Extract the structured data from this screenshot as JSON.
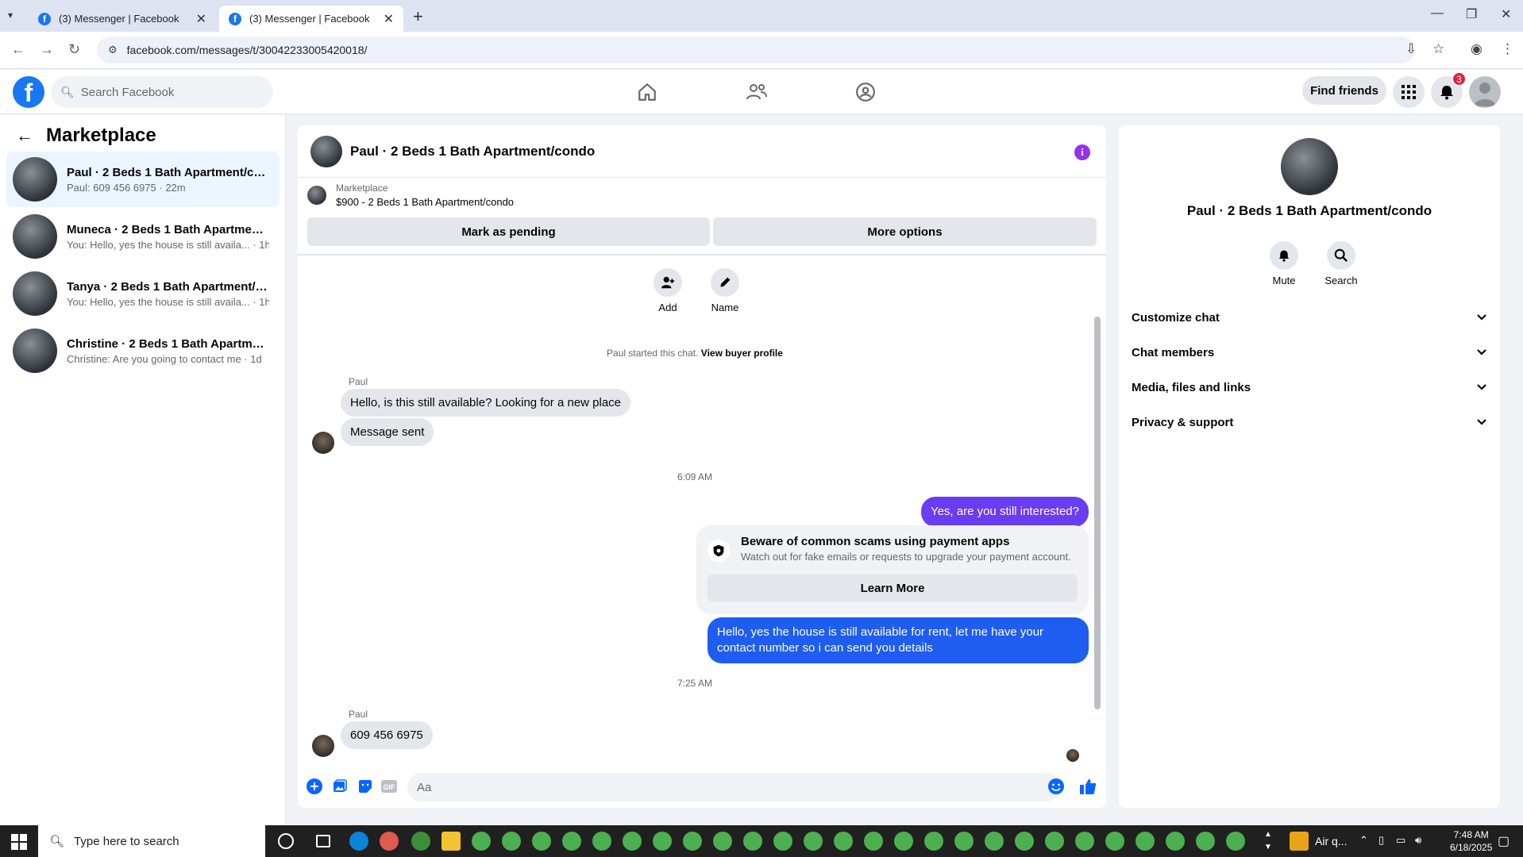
{
  "browser": {
    "tabs": [
      {
        "title": "(3) Messenger | Facebook"
      },
      {
        "title": "(3) Messenger | Facebook"
      }
    ],
    "url": "facebook.com/messages/t/30042233005420018/"
  },
  "fb_header": {
    "search_placeholder": "Search Facebook",
    "find_friends": "Find friends",
    "notification_count": "3"
  },
  "sidebar": {
    "title": "Marketplace",
    "conversations": [
      {
        "name": "Paul · 2 Beds 1 Bath Apartment/co...",
        "preview": "Paul: 609 456 6975 · 22m"
      },
      {
        "name": "Muneca · 2 Beds 1 Bath Apartment...",
        "preview": "You: Hello, yes the house is still availa... · 1h"
      },
      {
        "name": "Tanya · 2 Beds 1 Bath Apartment/c...",
        "preview": "You: Hello, yes the house is still availa... · 1h"
      },
      {
        "name": "Christine · 2 Beds 1 Bath Apartmen...",
        "preview": "Christine: Are you going to contact me · 1d"
      }
    ]
  },
  "chat": {
    "title": "Paul · 2 Beds 1 Bath Apartment/condo",
    "listing_category": "Marketplace",
    "listing_title": "$900 - 2 Beds 1 Bath Apartment/condo",
    "mark_pending": "Mark as pending",
    "more_options": "More options",
    "add_label": "Add",
    "name_label": "Name",
    "started_text": "Paul started this chat.",
    "buyer_profile": "View buyer profile",
    "sender_name": "Paul",
    "msg1": "Hello, is this still available? Looking for a new place",
    "msg2": "Message sent",
    "time1": "6:09 AM",
    "out1": "Yes, are you still interested?",
    "scam_title": "Beware of common scams using payment apps",
    "scam_body": "Watch out for fake emails or requests to upgrade your payment account.",
    "learn_more": "Learn More",
    "out2": "Hello, yes the house is still available for rent, let me have your contact number so i can send you details",
    "time2": "7:25 AM",
    "sender_name2": "Paul",
    "msg3": "609 456 6975",
    "composer_placeholder": "Aa"
  },
  "right_panel": {
    "name": "Paul · 2 Beds 1 Bath Apartment/condo",
    "mute": "Mute",
    "search": "Search",
    "sections": [
      "Customize chat",
      "Chat members",
      "Media, files and links",
      "Privacy & support"
    ]
  },
  "taskbar": {
    "search_placeholder": "Type here to search",
    "weather": "Air q...",
    "time": "7:48 AM",
    "date": "6/18/2025"
  },
  "colors": {
    "facebook_blue": "#1877f2",
    "outgoing_blue": "#1f5cf0",
    "outgoing_purple": "#6a3cf2",
    "info_purple": "#9333ea",
    "badge_red": "#e41e3f"
  }
}
